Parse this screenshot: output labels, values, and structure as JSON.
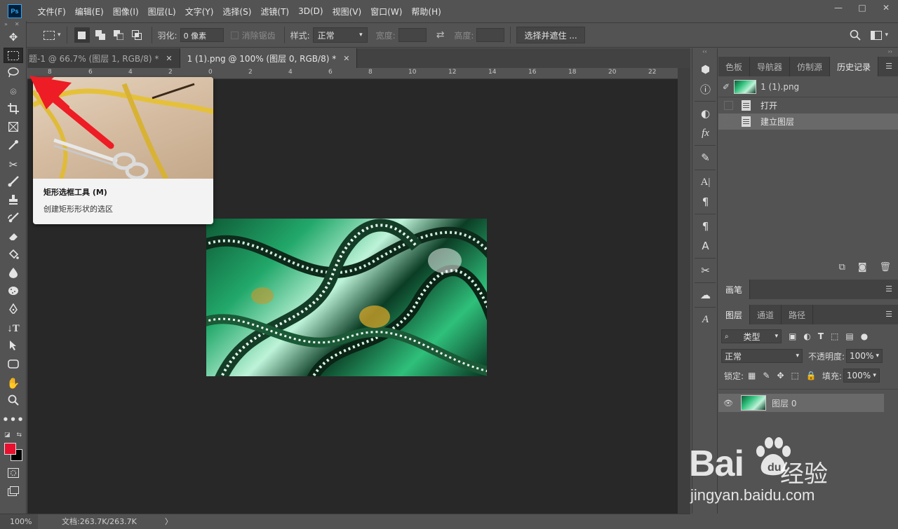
{
  "menu": {
    "logo": "Ps",
    "items": [
      "文件(F)",
      "编辑(E)",
      "图像(I)",
      "图层(L)",
      "文字(Y)",
      "选择(S)",
      "滤镜(T)",
      "3D(D)",
      "视图(V)",
      "窗口(W)",
      "帮助(H)"
    ]
  },
  "window_controls": {
    "minimize": "—",
    "restore": "□",
    "close": "✕"
  },
  "options": {
    "feather_label": "羽化:",
    "feather_value": "0 像素",
    "antialias_label": "消除锯齿",
    "style_label": "样式:",
    "style_value": "正常",
    "width_label": "宽度:",
    "swap_glyph": "⇄",
    "height_label": "高度:",
    "select_mask_button": "选择并遮住 ..."
  },
  "tabs": [
    {
      "label": "题-1 @ 66.7% (图层 1, RGB/8) *",
      "close": "✕"
    },
    {
      "label": "1 (1).png @ 100% (图层 0, RGB/8) *",
      "close": "✕"
    }
  ],
  "ruler": {
    "labels": [
      "8",
      "6",
      "4",
      "2",
      "0",
      "2",
      "4",
      "6",
      "8",
      "10",
      "12",
      "14",
      "16",
      "18",
      "20",
      "22"
    ]
  },
  "tooltip": {
    "title": "矩形选框工具 (M)",
    "description": "创建矩形形状的选区"
  },
  "statusbar": {
    "zoom": "100%",
    "doc_info": "文档:263.7K/263.7K",
    "arrow": "〉"
  },
  "history_panel": {
    "tabs": [
      "色板",
      "导航器",
      "仿制源",
      "历史记录"
    ],
    "active_tab": "历史记录",
    "snapshot_name": "1 (1).png",
    "states": [
      "打开",
      "建立图层"
    ]
  },
  "brush_panel": {
    "tab": "画笔"
  },
  "layers_panel": {
    "tabs": [
      "图层",
      "通道",
      "路径"
    ],
    "filter_value": "类型",
    "blend_mode": "正常",
    "opacity_label": "不透明度:",
    "opacity_value": "100%",
    "lock_label": "锁定:",
    "fill_label": "填充:",
    "fill_value": "100%",
    "layer_name": "图层 0"
  },
  "watermark": {
    "brand_left": "Bai",
    "brand_right": "经验",
    "url": "jingyan.baidu.com"
  },
  "colors": {
    "foreground": "#e8102e",
    "background": "#000000",
    "arrow": "#ee1c24",
    "ps_accent": "#31a8ff"
  }
}
